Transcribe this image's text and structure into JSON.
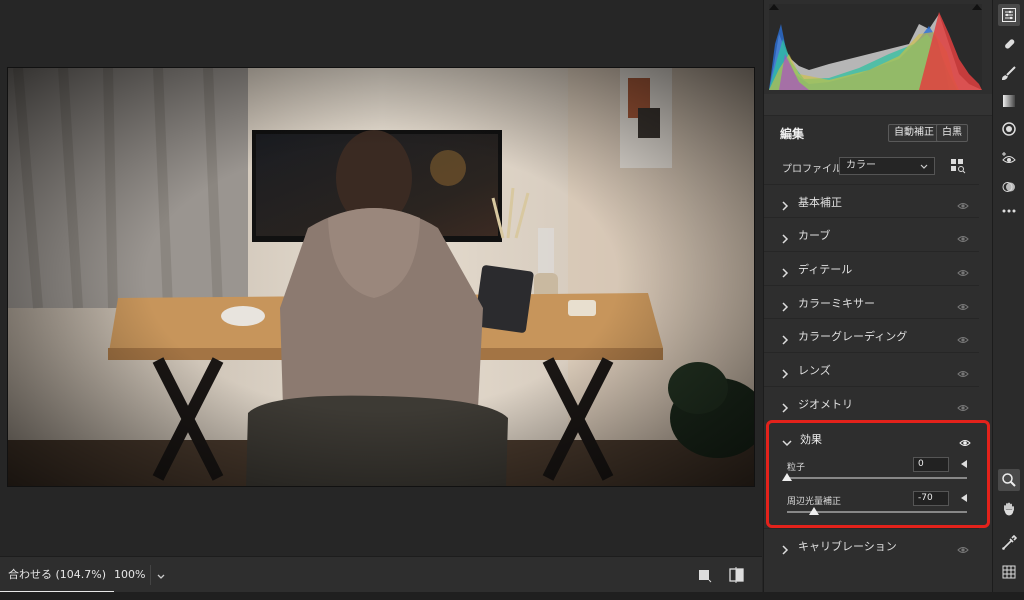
{
  "bottom_bar": {
    "fit_label": "合わせる (104.7%)",
    "zoom_value": "100%"
  },
  "panel": {
    "edit_title": "編集",
    "auto_button": "自動補正",
    "bw_button": "白黒",
    "profile_label": "プロファイル",
    "profile_value": "カラー",
    "sections": {
      "basic": "基本補正",
      "curve": "カーブ",
      "detail": "ディテール",
      "color_mixer": "カラーミキサー",
      "color_grading": "カラーグレーディング",
      "lens": "レンズ",
      "geometry": "ジオメトリ",
      "effects": "効果",
      "calibration": "キャリブレーション"
    },
    "effects": {
      "grain_label": "粒子",
      "grain_value": "0",
      "grain_level": 0,
      "vignette_label": "周辺光量補正",
      "vignette_value": "-70",
      "vignette_min": -100,
      "vignette_max": 100
    }
  },
  "colors": {
    "accent_highlight": "#e3221b",
    "panel_bg": "#2e2e2e",
    "canvas_bg": "#262626"
  },
  "icons": {
    "tool_rail": [
      "edit-sliders-icon",
      "healing-icon",
      "brush-icon",
      "gradient-icon",
      "radial-filter-icon",
      "red-eye-icon",
      "presets-icon",
      "more-icon",
      "zoom-icon",
      "hand-icon",
      "color-sampler-icon",
      "grid-icon"
    ]
  }
}
